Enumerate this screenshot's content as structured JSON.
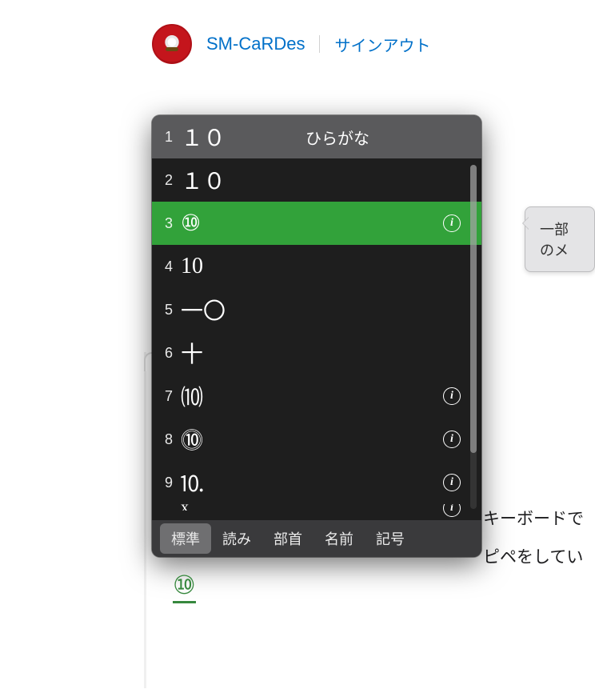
{
  "header": {
    "username": "SM-CaRDes",
    "signout_label": "サインアウト"
  },
  "tooltip": {
    "text": "一部のメ"
  },
  "background_text": {
    "line1": "キーボードで",
    "line2": "ピペをしてい"
  },
  "ime": {
    "header_candidate": "１０",
    "header_mode": "ひらがな",
    "candidates": [
      {
        "index": "1",
        "text": "１０",
        "info": false,
        "header": true
      },
      {
        "index": "2",
        "text": "１０",
        "info": false
      },
      {
        "index": "3",
        "text": "⑩",
        "info": true,
        "selected": true
      },
      {
        "index": "4",
        "text": "10",
        "info": false
      },
      {
        "index": "5",
        "text": "一〇",
        "info": false
      },
      {
        "index": "6",
        "text": "十",
        "info": false
      },
      {
        "index": "7",
        "text": "⑽",
        "info": true
      },
      {
        "index": "8",
        "text": "⓾",
        "info": true
      },
      {
        "index": "9",
        "text": "⒑",
        "info": true
      }
    ],
    "partial_info": true,
    "tabs": [
      {
        "label": "標準",
        "active": true
      },
      {
        "label": "読み",
        "active": false
      },
      {
        "label": "部首",
        "active": false
      },
      {
        "label": "名前",
        "active": false
      },
      {
        "label": "記号",
        "active": false
      }
    ]
  },
  "converted_output": "⑩"
}
